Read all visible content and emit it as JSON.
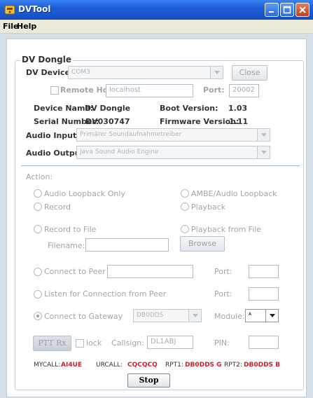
{
  "window": {
    "title": "DVTool",
    "icon": "dvtool-app-icon",
    "controls": [
      "minimize-icon",
      "maximize-icon",
      "close-icon"
    ]
  },
  "menu": {
    "file": "File",
    "help": "Help"
  },
  "group": {
    "title": "DV Dongle"
  },
  "device": {
    "label": "DV Device:",
    "value": "COM3",
    "close_button": "Close",
    "remote_host_label": "Remote Host:",
    "remote_host_checked": false,
    "remote_host_value": "localhost",
    "port_label": "Port:",
    "port_value": "20002"
  },
  "info": {
    "device_name_label": "Device Name:",
    "device_name_value": "DV Dongle",
    "boot_version_label": "Boot Version:",
    "boot_version_value": "1.03",
    "serial_label": "Serial Number:",
    "serial_value": "DV030747",
    "firmware_label": "Firmware Version:",
    "firmware_value": "1.11"
  },
  "audio": {
    "input_label": "Audio Input:",
    "input_value": "Primärer Soundaufnahmetreiber",
    "output_label": "Audio Output:",
    "output_value": "Java Sound Audio Engine"
  },
  "action": {
    "label": "Action:",
    "audio_loopback": "Audio Loopback Only",
    "ambe_loopback": "AMBE/Audio Loopback",
    "record": "Record",
    "playback": "Playback",
    "record_to_file": "Record to File",
    "playback_from_file": "Playback from File",
    "filename_label": "Filename:",
    "filename_value": "",
    "browse_button": "Browse",
    "connect_to_peer": "Connect to Peer",
    "peer_value": "",
    "peer_port_label": "Port:",
    "peer_port_value": "",
    "listen_for_peer": "Listen for Connection from Peer",
    "listen_port_label": "Port:",
    "listen_port_value": "",
    "connect_to_gateway": "Connect to Gateway",
    "gateway_value": "DB0DDS",
    "module_label": "Module:",
    "module_value": "A",
    "selected": "connect_to_gateway"
  },
  "controls": {
    "ptt_button": "PTT Rx",
    "lock_label": "lock",
    "lock_checked": false,
    "callsign_label": "Callsign:",
    "callsign_value": "DL1ABJ",
    "pin_label": "PIN:",
    "pin_value": ""
  },
  "status": {
    "mycall_label": "MYCALL:",
    "mycall_value": "AI4UE",
    "urcall_label": "URCALL:",
    "urcall_value": "CQCQCQ",
    "rpt1_label": "RPT1:",
    "rpt1_value": "DB0DDS G",
    "rpt2_label": "RPT2:",
    "rpt2_value": "DB0DDS B"
  },
  "stop_button": "Stop",
  "colors": {
    "titlebar": "#1e5fd6",
    "status_value": "#d21e2a",
    "disabled_text": "#a0a6ad",
    "frame_background": "#d4dfe8"
  }
}
